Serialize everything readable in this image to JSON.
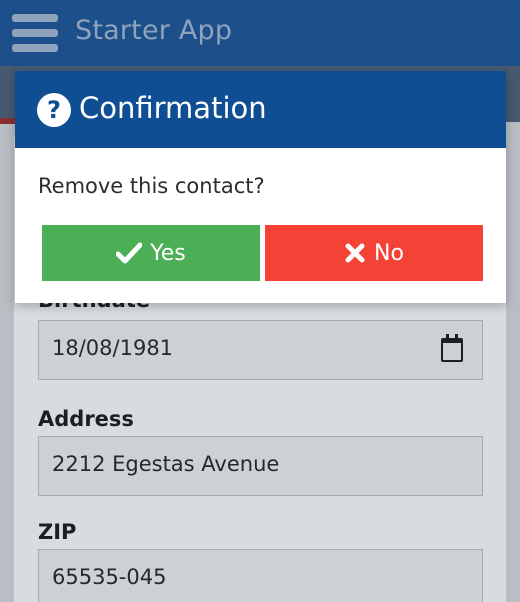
{
  "app": {
    "title": "Starter App",
    "menu_icon": "hamburger-menu-icon"
  },
  "colors": {
    "appbar": "#1d4f8a",
    "dialog_header": "#0f4e92",
    "yes_button": "#4cae55",
    "no_button": "#f44336"
  },
  "form": {
    "birthdate": {
      "label": "Birthdate",
      "value": "18/08/1981",
      "icon": "calendar-icon"
    },
    "address": {
      "label": "Address",
      "value": "2212 Egestas Avenue"
    },
    "zip": {
      "label": "ZIP",
      "value": "65535-045"
    }
  },
  "dialog": {
    "icon": "question-circle-icon",
    "title": "Confirmation",
    "message": "Remove this contact?",
    "yes": {
      "label": "Yes",
      "icon": "check-icon"
    },
    "no": {
      "label": "No",
      "icon": "close-icon"
    }
  }
}
